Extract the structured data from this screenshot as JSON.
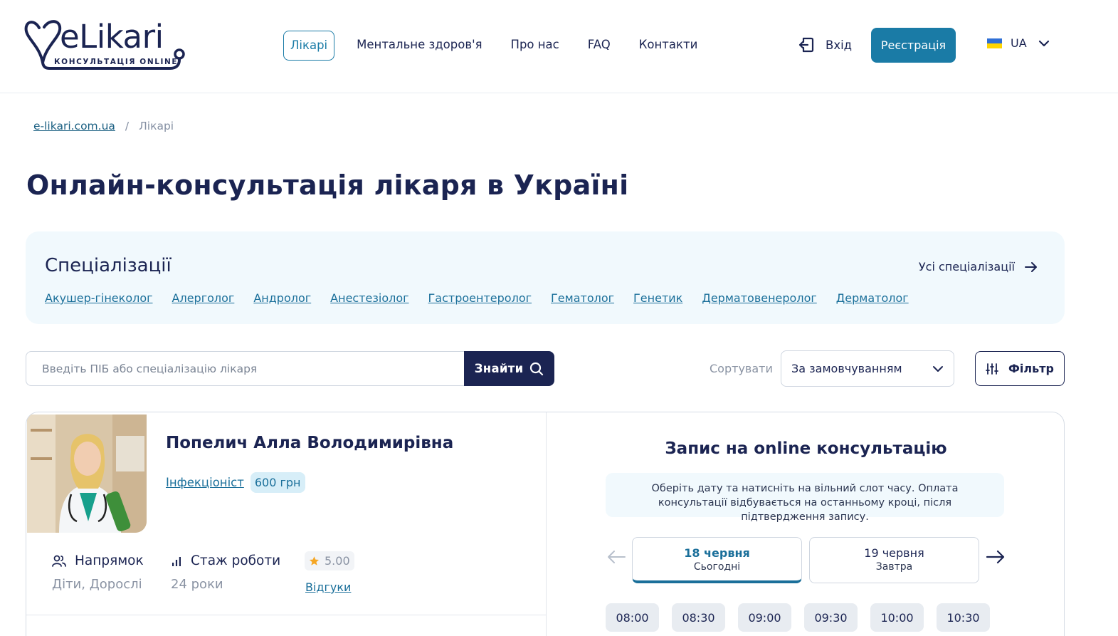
{
  "logo": {
    "word": "eLikari",
    "sub": "КОНСУЛЬТАЦІЯ ONLINE"
  },
  "nav": [
    {
      "label": "Лікарі",
      "active": true
    },
    {
      "label": "Ментальне здоров'я"
    },
    {
      "label": "Про нас"
    },
    {
      "label": "FAQ"
    },
    {
      "label": "Контакти"
    }
  ],
  "header": {
    "login_label": "Вхід",
    "register_label": "Реєстрація",
    "lang": "UA"
  },
  "breadcrumb": {
    "home": "e-likari.com.ua",
    "separator": "/",
    "current": "Лікарі"
  },
  "page_title": "Онлайн-консультація лікаря в Україні",
  "specializations": {
    "title": "Спеціалізації",
    "all_label": "Усі спеціалізації",
    "items": [
      "Акушер-гінеколог",
      "Алерголог",
      "Андролог",
      "Анестезіолог",
      "Гастроентеролог",
      "Гематолог",
      "Генетик",
      "Дерматовенеролог",
      "Дерматолог"
    ]
  },
  "search": {
    "placeholder": "Введіть ПІБ або спеціалізацію лікаря",
    "button_label": "Знайти"
  },
  "sort": {
    "label": "Сортувати",
    "value": "За замовчуванням"
  },
  "filter": {
    "label": "Фільтр"
  },
  "doctor": {
    "name": "Попелич Алла Володимирівна",
    "specialty": "Інфекціоніст",
    "price": "600 грн",
    "direction_label": "Напрямок",
    "direction_value": "Діти, Дорослі",
    "experience_label": "Стаж роботи",
    "experience_value": "24 роки",
    "rating": "5.00",
    "reviews_label": "Відгуки"
  },
  "booking": {
    "title": "Запис на online консультацію",
    "note": "Оберіть дату та натисніть на вільний слот часу. Оплата консультації відбувається на останньому кроці, після підтвердження запису.",
    "dates": [
      {
        "date": "18 червня",
        "sub": "Сьогодні",
        "active": true
      },
      {
        "date": "19 червня",
        "sub": "Завтра"
      }
    ],
    "slots": [
      "08:00",
      "08:30",
      "09:00",
      "09:30",
      "10:00",
      "10:30"
    ]
  },
  "colors": {
    "primary": "#1b2452",
    "accent": "#1a7ba6",
    "link": "#1a6f9a",
    "spec_bg": "#f1f9fd",
    "rating_star": "#f5a623"
  }
}
